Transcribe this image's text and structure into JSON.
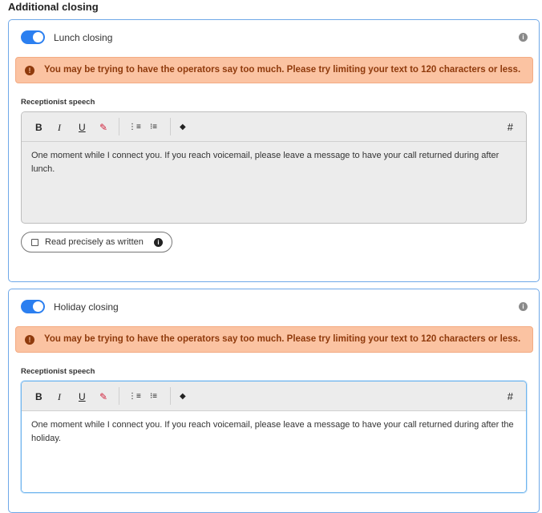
{
  "section_title": "Additional closing",
  "cards": [
    {
      "title": "Lunch closing",
      "toggle_on": true,
      "info_icon": "info-circle-icon",
      "warning": {
        "icon": "!",
        "text": "You may be trying to have the operators say too much. Please try limiting your text to 120 characters or less."
      },
      "speech_label": "Receptionist speech",
      "editor_text": "One moment while I connect you. If you reach voicemail, please leave a message to have your call returned during after lunch.",
      "read_precisely_label": "Read precisely as written"
    },
    {
      "title": "Holiday closing",
      "toggle_on": true,
      "info_icon": "info-circle-icon",
      "warning": {
        "icon": "!",
        "text": "You may be trying to have the operators say too much. Please try limiting your text to 120 characters or less."
      },
      "speech_label": "Receptionist speech",
      "editor_text": "One moment while I connect you. If you reach voicemail, please leave a message to have your call returned during after the holiday."
    }
  ],
  "toolbar": {
    "bold": "B",
    "italic": "I",
    "underline": "U",
    "highlight": "✎",
    "ordered_list": "⋮≡",
    "bullet_list": "⁝≡",
    "eraser": "◆",
    "hash": "#"
  },
  "info_glyph": "i",
  "colors": {
    "accent": "#2b7ff0",
    "card_border": "#6fa8e8",
    "warning_bg": "#fbc3a2",
    "warning_text": "#8f3a0c"
  }
}
